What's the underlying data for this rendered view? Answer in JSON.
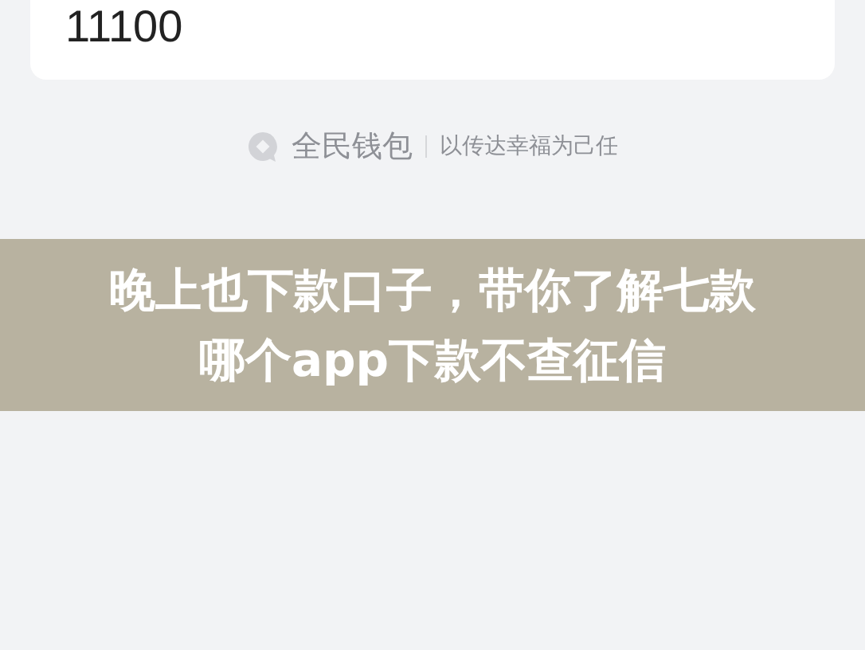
{
  "card": {
    "amount": "11100"
  },
  "footer": {
    "brand": "全民钱包",
    "slogan": "以传达幸福为己任"
  },
  "banner": {
    "title": "晚上也下款口子，带你了解七款哪个app下款不查征信"
  }
}
